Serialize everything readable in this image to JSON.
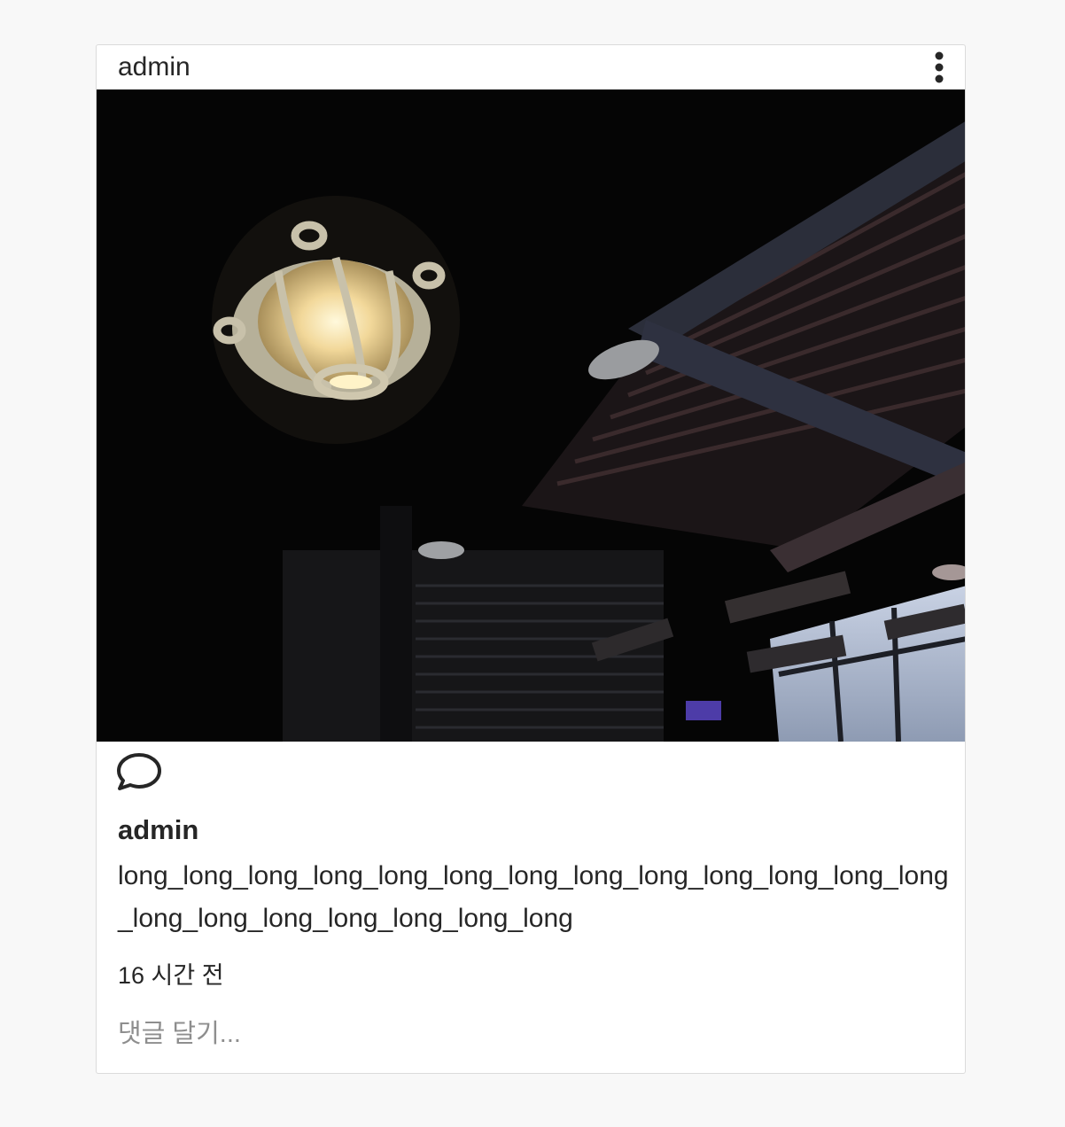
{
  "post": {
    "author": "admin",
    "caption_author": "admin",
    "caption_text": "long_long_long_long_long_long_long_long_long_long_long_long_long_long_long_long_long_long_long_long",
    "timestamp": "16 시간 전",
    "comment_placeholder": "댓글 달기...",
    "photo_description": "dark ceiling with caged lamp and industrial beams"
  },
  "icons": {
    "more": "more-vertical-icon",
    "comment": "comment-bubble-icon"
  },
  "colors": {
    "background": "#f8f8f8",
    "card": "#ffffff",
    "border": "#dbdbdb",
    "text": "#262626",
    "muted": "#8e8e8e"
  }
}
